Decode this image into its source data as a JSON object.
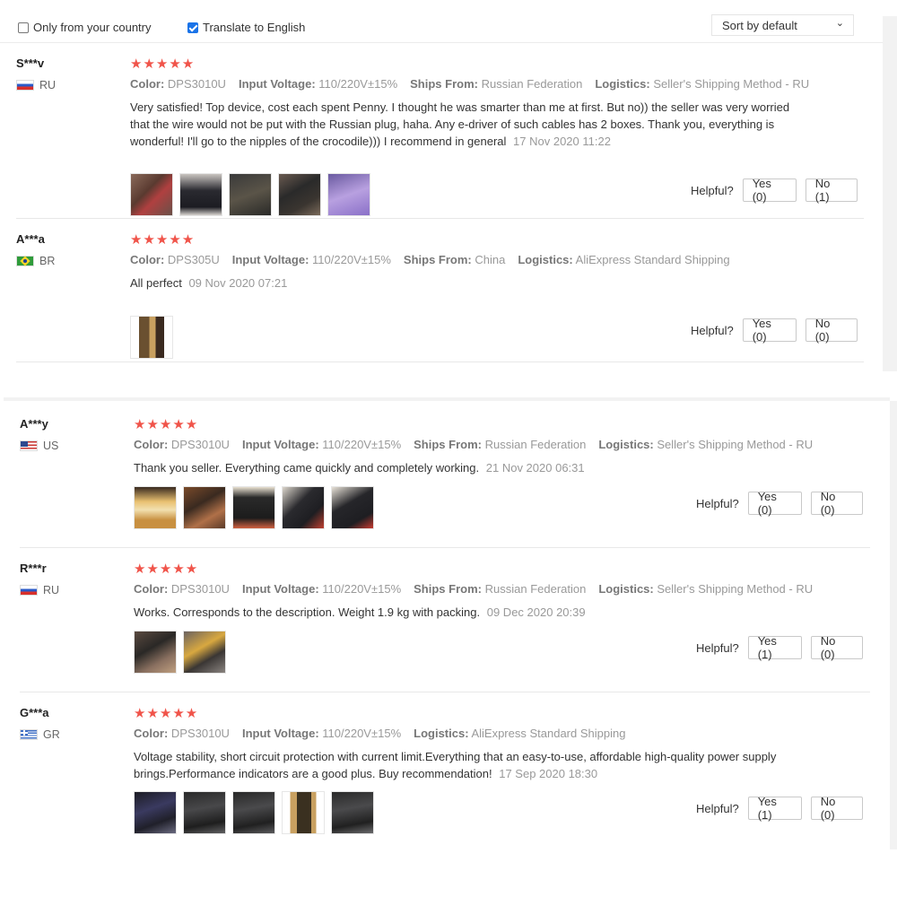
{
  "filters": {
    "only_country_label": "Only from your country",
    "only_country_checked": false,
    "translate_label": "Translate to English",
    "translate_checked": true,
    "sort_label": "Sort by default",
    "sort_icon": "chevron-down-icon"
  },
  "labels": {
    "color": "Color:",
    "voltage": "Input Voltage:",
    "ships_from": "Ships From:",
    "logistics": "Logistics:",
    "helpful": "Helpful?"
  },
  "star_color": "#f0544a",
  "reviews": [
    {
      "name": "S***v",
      "country": "RU",
      "stars": 5,
      "star_text": "★★★★★",
      "color": "DPS3010U",
      "voltage": "110/220V±15%",
      "ships_from": "Russian Federation",
      "logistics": "Seller's Shipping Method - RU",
      "comment": "Very satisfied! Top device, cost each spent Penny. I thought he was smarter than me at first. But no)) the seller was very worried that the wire would not be put with the Russian plug, haha. Any e-driver of such cables has 2 boxes. Thank you, everything is wonderful! I'll go to the nipples of the crocodile))) I recommend in general",
      "date": "17 Nov 2020 11:22",
      "yes": "Yes (0)",
      "no": "No (1)"
    },
    {
      "name": "A***a",
      "country": "BR",
      "stars": 5,
      "star_text": "★★★★★",
      "color": "DPS305U",
      "voltage": "110/220V±15%",
      "ships_from": "China",
      "logistics": "AliExpress Standard Shipping",
      "comment": "All perfect",
      "date": "09 Nov 2020 07:21",
      "yes": "Yes (0)",
      "no": "No (0)"
    },
    {
      "name": "A***y",
      "country": "US",
      "stars": 5,
      "star_text": "★★★★★",
      "color": "DPS3010U",
      "voltage": "110/220V±15%",
      "ships_from": "Russian Federation",
      "logistics": "Seller's Shipping Method - RU",
      "comment": "Thank you seller. Everything came quickly and completely working.",
      "date": "21 Nov 2020 06:31",
      "yes": "Yes (0)",
      "no": "No (0)"
    },
    {
      "name": "R***r",
      "country": "RU",
      "stars": 5,
      "star_text": "★★★★★",
      "color": "DPS3010U",
      "voltage": "110/220V±15%",
      "ships_from": "Russian Federation",
      "logistics": "Seller's Shipping Method - RU",
      "comment": "Works. Corresponds to the description. Weight 1.9 kg with packing.",
      "date": "09 Dec 2020 20:39",
      "yes": "Yes (1)",
      "no": "No (0)"
    },
    {
      "name": "G***a",
      "country": "GR",
      "stars": 5,
      "star_text": "★★★★★",
      "color": "DPS3010U",
      "voltage": "110/220V±15%",
      "logistics": "AliExpress Standard Shipping",
      "comment": "Voltage stability, short circuit protection with current limit.Everything that an easy-to-use, affordable high-quality power supply brings.Performance indicators are a good plus. Buy recommendation!",
      "date": "17 Sep 2020 18:30",
      "yes": "Yes (1)",
      "no": "No (0)"
    }
  ]
}
